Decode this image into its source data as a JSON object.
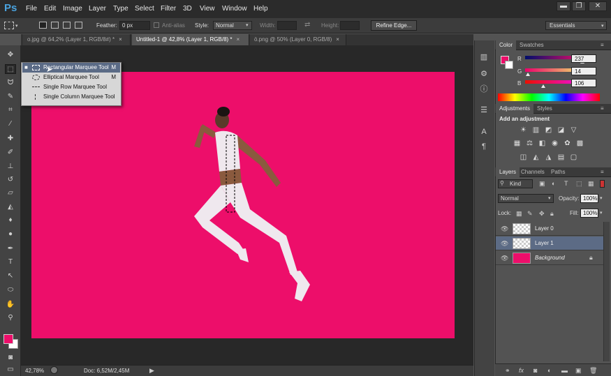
{
  "app": {
    "logo": "Ps"
  },
  "menu": [
    "File",
    "Edit",
    "Image",
    "Layer",
    "Type",
    "Select",
    "Filter",
    "3D",
    "View",
    "Window",
    "Help"
  ],
  "window_buttons": {
    "minimize": "▬",
    "restore": "❐",
    "close": "✕"
  },
  "options_bar": {
    "feather_label": "Feather:",
    "feather_value": "0 px",
    "antialias_label": "Anti-alias",
    "style_label": "Style:",
    "style_value": "Normal",
    "width_label": "Width:",
    "height_label": "Height:",
    "refine_edge": "Refine Edge...",
    "workspace": "Essentials"
  },
  "tabs": [
    {
      "label": "o.jpg @ 64,2% (Layer 1, RGB/8#) *",
      "active": false
    },
    {
      "label": "Untitled-1 @ 42,8% (Layer 1, RGB/8) *",
      "active": true
    },
    {
      "label": "ö.png @ 50% (Layer 0, RGB/8)",
      "active": false
    }
  ],
  "tab_close": "×",
  "flyout": [
    {
      "label": "Rectangular Marquee Tool",
      "key": "M",
      "selected": true
    },
    {
      "label": "Elliptical Marquee Tool",
      "key": "M",
      "selected": false
    },
    {
      "label": "Single Row Marquee Tool",
      "key": "",
      "selected": false
    },
    {
      "label": "Single Column Marquee Tool",
      "key": "",
      "selected": false
    }
  ],
  "status": {
    "zoom": "42,78%",
    "doc": "Doc: 6,52M/2,45M"
  },
  "color_panel": {
    "tabs": [
      "Color",
      "Swatches"
    ],
    "r_label": "R",
    "r_value": "237",
    "g_label": "G",
    "g_value": "14",
    "b_label": "B",
    "b_value": "106",
    "foreground": "#ed0e6a"
  },
  "adjustments_panel": {
    "tabs": [
      "Adjustments",
      "Styles"
    ],
    "heading": "Add an adjustment"
  },
  "layers_panel": {
    "tabs": [
      "Layers",
      "Channels",
      "Paths"
    ],
    "kind": "Kind",
    "blend_mode": "Normal",
    "opacity_label": "Opacity:",
    "opacity_value": "100%",
    "lock_label": "Lock:",
    "fill_label": "Fill:",
    "fill_value": "100%",
    "layers": [
      {
        "name": "Layer 0",
        "selected": false,
        "type": "transparent"
      },
      {
        "name": "Layer 1",
        "selected": true,
        "type": "transparent"
      },
      {
        "name": "Background",
        "selected": false,
        "type": "fill",
        "locked": true
      }
    ]
  },
  "canvas": {
    "background_color": "#ed0e6a"
  }
}
